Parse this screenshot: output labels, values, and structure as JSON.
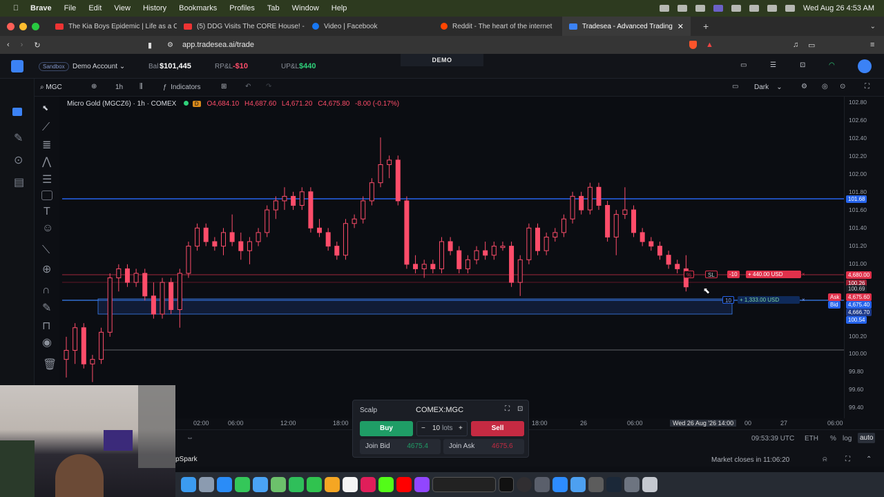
{
  "menubar": {
    "app": "Brave",
    "items": [
      "File",
      "Edit",
      "View",
      "History",
      "Bookmarks",
      "Profiles",
      "Tab",
      "Window",
      "Help"
    ],
    "clock": "Wed Aug 26  4:53 AM"
  },
  "tabs": [
    {
      "label": "The Kia Boys Epidemic | Life as a C",
      "color": "#e33"
    },
    {
      "label": "(5) DDG Visits The CORE House! -",
      "color": "#e33"
    },
    {
      "label": "Video | Facebook",
      "color": "#1877f2"
    },
    {
      "label": "Reddit - The heart of the internet",
      "color": "#ff4500"
    },
    {
      "label": "Tradesea - Advanced Trading",
      "color": "#3b82f6"
    }
  ],
  "address": {
    "url": "app.tradesea.ai/trade"
  },
  "header": {
    "sandbox": "Sandbox",
    "account": "Demo Account",
    "bal_label": "Bal",
    "bal_value": "$101,445",
    "rpl_label": "RP&L",
    "rpl_value": "-$10",
    "upl_label": "UP&L",
    "upl_value": "$440",
    "mode": "DEMO"
  },
  "toolbar": {
    "symbol": "MGC",
    "interval": "1h",
    "indicators": "Indicators",
    "theme": "Dark"
  },
  "legend": {
    "title": "Micro Gold (MGCZ6) · 1h · COMEX",
    "badge": "D",
    "o": "O4,684.10",
    "h": "H4,687.60",
    "l": "L4,671.20",
    "c": "C4,675.80",
    "chg": "-8.00 (-0.17%)"
  },
  "price_axis": {
    "ticks": [
      "102.80",
      "102.60",
      "102.40",
      "102.20",
      "102.00",
      "101.80",
      "101.60",
      "101.40",
      "101.20",
      "101.00",
      "100.20",
      "100.00",
      "99.80",
      "99.60",
      "99.40"
    ],
    "labels": {
      "blue_line": "101.68",
      "red_line": "4,680.00",
      "red_line2": "100.26",
      "last": "100.69",
      "ask_tag": "Ask",
      "ask": "4,675.60",
      "bid_tag": "Bid",
      "bid": "4,675.40",
      "pos": "4,666.70",
      "pos2": "100.54"
    }
  },
  "orders": {
    "pct": "%",
    "sl": "SL",
    "qty_short": "-10",
    "tp_pnl": "+ 440.00 USD",
    "qty_long": "10",
    "pos_pnl": "+ 1,333.00 USD",
    "close": "×"
  },
  "time_axis": {
    "ticks": [
      "02:00",
      "06:00",
      "12:00",
      "18:00",
      "18:00",
      "26",
      "06:00",
      "Wed 26 Aug '26  14:00",
      "00",
      "27",
      "06:00"
    ]
  },
  "bottom": {
    "clock": "09:53:39 UTC",
    "currency": "ETH",
    "pct": "%",
    "log": "log",
    "auto": "auto",
    "market": "Market closes in 11:06:20",
    "app_name": "pSpark"
  },
  "order_widget": {
    "mode": "Scalp",
    "symbol": "COMEX:MGC",
    "buy": "Buy",
    "sell": "Sell",
    "qty": "10",
    "unit": "lots",
    "minus": "−",
    "plus": "+",
    "join_bid": "Join Bid",
    "join_bid_price": "4675.4",
    "join_ask": "Join Ask",
    "join_ask_price": "4675.6"
  },
  "chart_data": {
    "type": "candlestick",
    "symbol": "MGCZ6",
    "ylim": [
      99.3,
      102.85
    ],
    "candles": [
      {
        "o": 99.95,
        "h": 100.2,
        "l": 99.75,
        "c": 100.05
      },
      {
        "o": 100.05,
        "h": 100.35,
        "l": 99.9,
        "c": 100.3
      },
      {
        "o": 100.3,
        "h": 100.35,
        "l": 99.85,
        "c": 99.9
      },
      {
        "o": 99.9,
        "h": 100.0,
        "l": 99.7,
        "c": 99.95
      },
      {
        "o": 99.95,
        "h": 100.3,
        "l": 99.9,
        "c": 100.25
      },
      {
        "o": 100.25,
        "h": 100.9,
        "l": 100.2,
        "c": 100.85
      },
      {
        "o": 100.85,
        "h": 101.0,
        "l": 100.7,
        "c": 100.95
      },
      {
        "o": 100.95,
        "h": 101.0,
        "l": 100.75,
        "c": 100.8
      },
      {
        "o": 100.8,
        "h": 100.95,
        "l": 100.75,
        "c": 100.9
      },
      {
        "o": 100.9,
        "h": 100.95,
        "l": 100.6,
        "c": 100.65
      },
      {
        "o": 100.65,
        "h": 100.8,
        "l": 100.4,
        "c": 100.45
      },
      {
        "o": 100.45,
        "h": 100.85,
        "l": 100.4,
        "c": 100.8
      },
      {
        "o": 100.8,
        "h": 100.85,
        "l": 100.45,
        "c": 100.5
      },
      {
        "o": 100.5,
        "h": 100.95,
        "l": 100.3,
        "c": 100.9
      },
      {
        "o": 100.9,
        "h": 101.25,
        "l": 100.85,
        "c": 101.2
      },
      {
        "o": 101.2,
        "h": 101.45,
        "l": 101.15,
        "c": 101.4
      },
      {
        "o": 101.4,
        "h": 101.45,
        "l": 101.2,
        "c": 101.25
      },
      {
        "o": 101.25,
        "h": 101.3,
        "l": 101.15,
        "c": 101.2
      },
      {
        "o": 101.2,
        "h": 101.4,
        "l": 101.1,
        "c": 101.35
      },
      {
        "o": 101.35,
        "h": 101.55,
        "l": 101.2,
        "c": 101.25
      },
      {
        "o": 101.25,
        "h": 101.35,
        "l": 101.05,
        "c": 101.15
      },
      {
        "o": 101.15,
        "h": 101.3,
        "l": 101.0,
        "c": 101.25
      },
      {
        "o": 101.25,
        "h": 101.4,
        "l": 101.2,
        "c": 101.35
      },
      {
        "o": 101.35,
        "h": 101.65,
        "l": 101.3,
        "c": 101.6
      },
      {
        "o": 101.6,
        "h": 101.75,
        "l": 101.5,
        "c": 101.7
      },
      {
        "o": 101.7,
        "h": 101.85,
        "l": 101.6,
        "c": 101.75
      },
      {
        "o": 101.75,
        "h": 101.8,
        "l": 101.6,
        "c": 101.65
      },
      {
        "o": 101.65,
        "h": 101.85,
        "l": 101.6,
        "c": 101.8
      },
      {
        "o": 101.8,
        "h": 101.85,
        "l": 101.35,
        "c": 101.4
      },
      {
        "o": 101.4,
        "h": 101.5,
        "l": 101.3,
        "c": 101.35
      },
      {
        "o": 101.35,
        "h": 101.4,
        "l": 101.15,
        "c": 101.2
      },
      {
        "o": 101.2,
        "h": 101.25,
        "l": 101.05,
        "c": 101.1
      },
      {
        "o": 101.1,
        "h": 101.5,
        "l": 101.05,
        "c": 101.45
      },
      {
        "o": 101.45,
        "h": 101.55,
        "l": 101.4,
        "c": 101.5
      },
      {
        "o": 101.5,
        "h": 101.75,
        "l": 101.45,
        "c": 101.7
      },
      {
        "o": 101.7,
        "h": 101.95,
        "l": 101.65,
        "c": 101.9
      },
      {
        "o": 101.9,
        "h": 102.4,
        "l": 101.85,
        "c": 102.1
      },
      {
        "o": 102.1,
        "h": 102.2,
        "l": 101.95,
        "c": 102.15
      },
      {
        "o": 102.15,
        "h": 102.2,
        "l": 101.65,
        "c": 101.7
      },
      {
        "o": 101.7,
        "h": 101.75,
        "l": 100.95,
        "c": 101.0
      },
      {
        "o": 101.0,
        "h": 101.1,
        "l": 100.9,
        "c": 100.95
      },
      {
        "o": 100.95,
        "h": 101.05,
        "l": 100.85,
        "c": 101.0
      },
      {
        "o": 101.0,
        "h": 101.05,
        "l": 100.9,
        "c": 100.95
      },
      {
        "o": 100.95,
        "h": 101.3,
        "l": 100.9,
        "c": 101.25
      },
      {
        "o": 101.25,
        "h": 101.3,
        "l": 101.1,
        "c": 101.15
      },
      {
        "o": 101.15,
        "h": 101.2,
        "l": 100.9,
        "c": 100.95
      },
      {
        "o": 100.95,
        "h": 101.1,
        "l": 100.9,
        "c": 101.05
      },
      {
        "o": 101.05,
        "h": 101.2,
        "l": 101.0,
        "c": 101.15
      },
      {
        "o": 101.15,
        "h": 101.25,
        "l": 101.05,
        "c": 101.1
      },
      {
        "o": 101.1,
        "h": 101.25,
        "l": 101.05,
        "c": 101.2
      },
      {
        "o": 101.2,
        "h": 101.25,
        "l": 101.15,
        "c": 101.2
      },
      {
        "o": 101.2,
        "h": 101.25,
        "l": 100.75,
        "c": 100.8
      },
      {
        "o": 100.8,
        "h": 101.1,
        "l": 100.65,
        "c": 101.05
      },
      {
        "o": 101.05,
        "h": 101.45,
        "l": 101.0,
        "c": 101.4
      },
      {
        "o": 101.4,
        "h": 101.45,
        "l": 101.1,
        "c": 101.15
      },
      {
        "o": 101.15,
        "h": 101.35,
        "l": 101.1,
        "c": 101.3
      },
      {
        "o": 101.3,
        "h": 101.4,
        "l": 101.25,
        "c": 101.35
      },
      {
        "o": 101.35,
        "h": 101.55,
        "l": 101.3,
        "c": 101.5
      },
      {
        "o": 101.5,
        "h": 101.8,
        "l": 101.45,
        "c": 101.75
      },
      {
        "o": 101.75,
        "h": 101.8,
        "l": 101.55,
        "c": 101.6
      },
      {
        "o": 101.6,
        "h": 101.9,
        "l": 101.55,
        "c": 101.85
      },
      {
        "o": 101.85,
        "h": 101.9,
        "l": 101.6,
        "c": 101.65
      },
      {
        "o": 101.65,
        "h": 101.7,
        "l": 101.25,
        "c": 101.3
      },
      {
        "o": 101.3,
        "h": 101.6,
        "l": 101.1,
        "c": 101.55
      },
      {
        "o": 101.55,
        "h": 101.85,
        "l": 101.5,
        "c": 101.6
      },
      {
        "o": 101.6,
        "h": 101.65,
        "l": 101.3,
        "c": 101.35
      },
      {
        "o": 101.35,
        "h": 101.4,
        "l": 101.2,
        "c": 101.25
      },
      {
        "o": 101.25,
        "h": 101.3,
        "l": 101.15,
        "c": 101.2
      },
      {
        "o": 101.2,
        "h": 101.25,
        "l": 101.05,
        "c": 101.1
      },
      {
        "o": 101.1,
        "h": 101.15,
        "l": 100.95,
        "c": 101.0
      },
      {
        "o": 101.0,
        "h": 101.05,
        "l": 100.9,
        "c": 100.95
      },
      {
        "o": 100.95,
        "h": 101.1,
        "l": 100.7,
        "c": 100.75
      }
    ]
  }
}
